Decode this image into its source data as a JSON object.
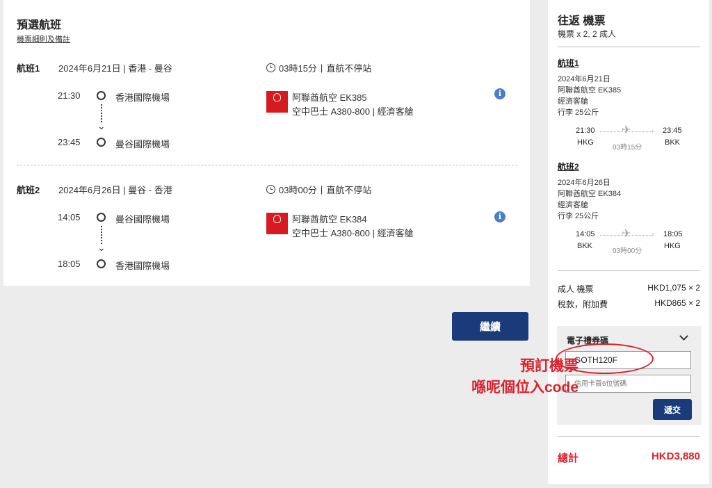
{
  "main": {
    "title": "預選航班",
    "rules_link": "機票細則及備註",
    "divider": "|",
    "segments": [
      {
        "label": "航班1",
        "date_route": "2024年6月21日 | 香港 - 曼谷",
        "duration": "03時15分",
        "nonstop": "直航不停站",
        "dep_time": "21:30",
        "dep_airport": "香港國際機場",
        "arr_time": "23:45",
        "arr_airport": "曼谷國際機場",
        "airline": "阿聯酋航空 EK385",
        "aircraft": "空中巴士 A380-800",
        "cabin": "經濟客艙"
      },
      {
        "label": "航班2",
        "date_route": "2024年6月26日 | 曼谷 - 香港",
        "duration": "03時00分",
        "nonstop": "直航不停站",
        "dep_time": "14:05",
        "dep_airport": "曼谷國際機場",
        "arr_time": "18:05",
        "arr_airport": "香港國際機場",
        "airline": "阿聯酋航空 EK384",
        "aircraft": "空中巴士 A380-800",
        "cabin": "經濟客艙"
      }
    ],
    "continue_label": "繼續"
  },
  "summary": {
    "title": "往返 機票",
    "subtitle": "機票 x 2, 2 成人",
    "legs": [
      {
        "title": "航班1",
        "date": "2024年6月21日",
        "airline": "阿聯酋航空 EK385",
        "cabin": "經濟客艙",
        "baggage": "行李 25公斤",
        "dep_time": "21:30",
        "arr_time": "23:45",
        "dep_code": "HKG",
        "arr_code": "BKK",
        "duration": "03時15分"
      },
      {
        "title": "航班2",
        "date": "2024年6月26日",
        "airline": "阿聯酋航空 EK384",
        "cabin": "經濟客艙",
        "baggage": "行李 25公斤",
        "dep_time": "14:05",
        "arr_time": "18:05",
        "dep_code": "BKK",
        "arr_code": "HKG",
        "duration": "03時00分"
      }
    ],
    "prices": [
      {
        "label": "成人 機票",
        "value": "HKD1,075 × 2"
      },
      {
        "label": "稅款，附加費",
        "value": "HKD865 × 2"
      }
    ],
    "voucher": {
      "title": "電子禮券碼",
      "code_value": "GOTH120F",
      "card_placeholder": "信用卡首6位號碼",
      "submit_label": "遞交"
    },
    "total_label": "總計",
    "total_value": "HKD3,880"
  },
  "annotation": {
    "line1": "預訂機票",
    "line2": "喺呢個位入code",
    "color": "#d9232d"
  },
  "colors": {
    "navy_button": "#1a3a7a",
    "emirates_red": "#d71920",
    "info_blue": "#4a7ec2",
    "total_red": "#d9232d"
  }
}
